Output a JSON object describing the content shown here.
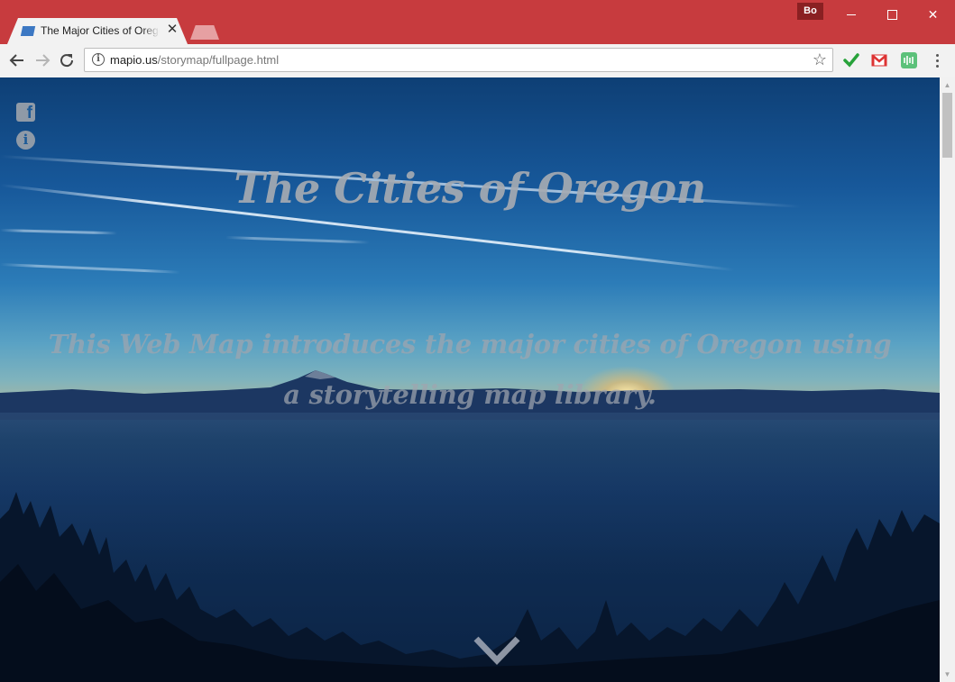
{
  "browser": {
    "tab": {
      "title": "The Major Cities of Oregon",
      "close_glyph": "✕",
      "favicon": "map-favicon-icon"
    },
    "profile_badge": "Bo",
    "window_controls": {
      "minimize": "minimize-icon",
      "maximize": "maximize-icon",
      "close": "✕"
    },
    "address_bar": {
      "host": "mapio.us",
      "path": "/storymap/fullpage.html",
      "info_glyph": "i",
      "star_glyph": "☆"
    },
    "extensions": [
      "check-extension-icon",
      "gmail-extension-icon",
      "green-extension-icon"
    ]
  },
  "page": {
    "title": "The Cities of Oregon",
    "subtitle": "This Web Map introduces the major cities of Oregon using a storytelling map library.",
    "social": {
      "facebook_glyph": "f",
      "info_glyph": "i"
    }
  },
  "scrollbar": {
    "up_glyph": "▲",
    "down_glyph": "▼"
  },
  "colors": {
    "browser_frame": "#c73b3e",
    "toolbar": "#f2f2f2",
    "sky_top": "#0e3f75",
    "title_text": "#a5aab2"
  }
}
